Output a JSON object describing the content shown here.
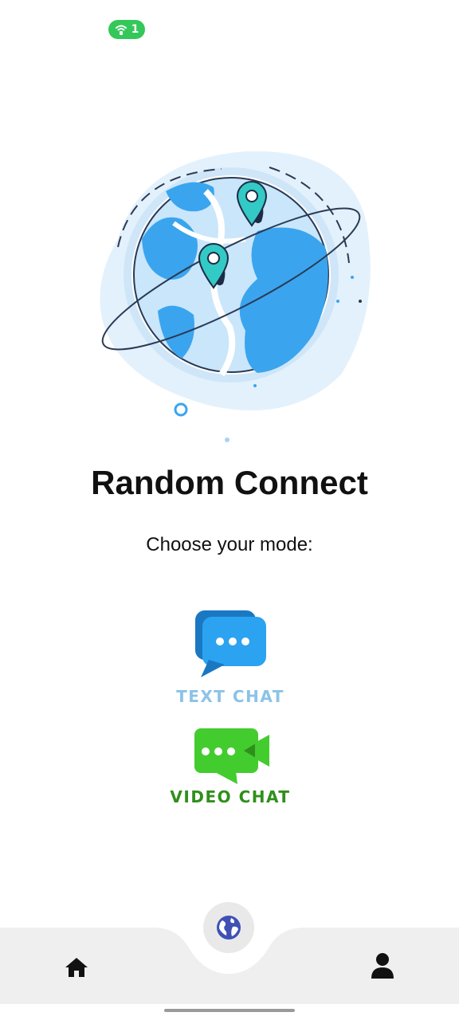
{
  "status_bar": {
    "hotspot_count": "1",
    "hotspot_icon": "wifi-hotspot-icon",
    "pill_color": "#34c759"
  },
  "hero": {
    "illustration": "globe-with-location-pins"
  },
  "app_title": "Random Connect",
  "subtitle": "Choose your mode:",
  "modes": [
    {
      "label": "TEXT CHAT",
      "icon": "text-chat-bubble-icon",
      "color": "#8cc3e6"
    },
    {
      "label": "VIDEO CHAT",
      "icon": "video-chat-camera-icon",
      "color": "#2f8f1c"
    }
  ],
  "bottom_nav": {
    "items": [
      {
        "icon": "home-icon"
      },
      {
        "icon": "globe-icon",
        "active": true
      },
      {
        "icon": "profile-icon"
      }
    ],
    "background": "#efefef",
    "globe_color": "#3f51b5"
  }
}
